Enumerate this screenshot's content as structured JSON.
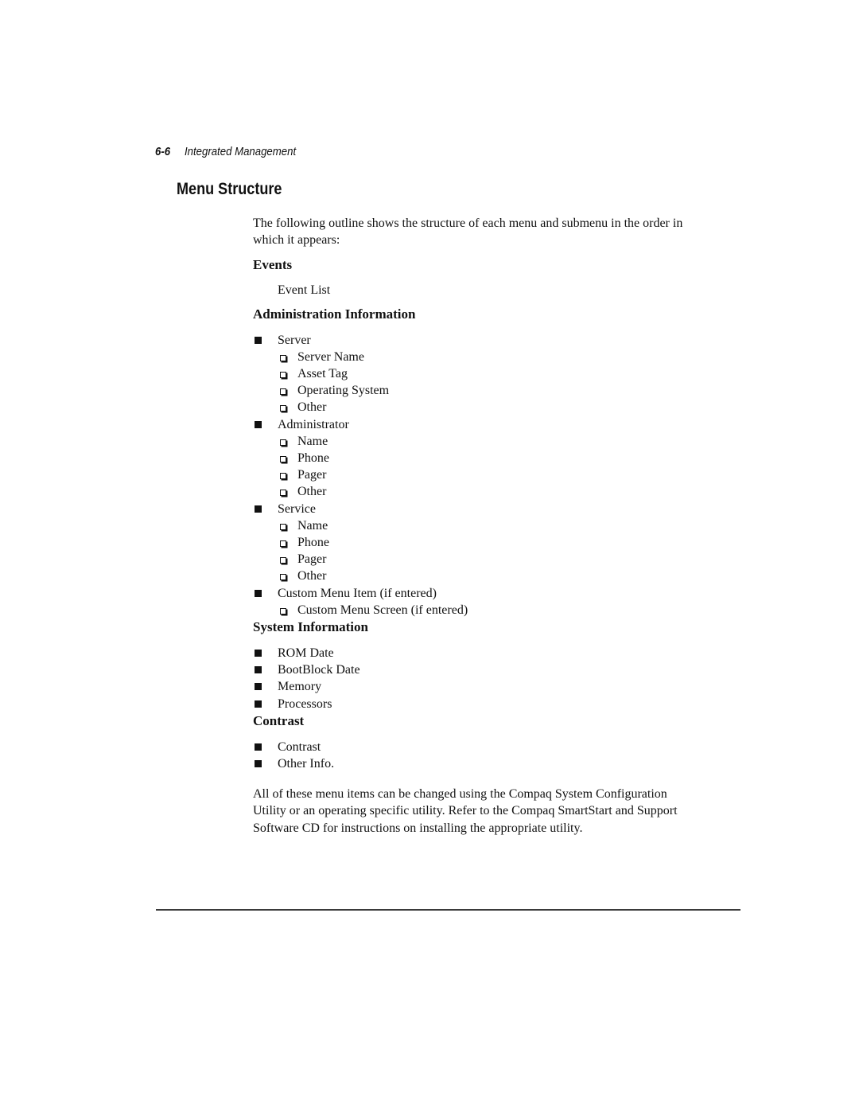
{
  "header": {
    "page_number": "6-6",
    "chapter_title": "Integrated Management"
  },
  "section_title": "Menu Structure",
  "intro": "The following outline shows the structure of each menu and submenu in the order in which it appears:",
  "menus": [
    {
      "title": "Events",
      "plain_items": [
        "Event List"
      ]
    },
    {
      "title": "Administration Information",
      "items": [
        {
          "label": "Server",
          "children": [
            "Server Name",
            "Asset Tag",
            "Operating System",
            "Other"
          ]
        },
        {
          "label": "Administrator",
          "children": [
            "Name",
            "Phone",
            "Pager",
            "Other"
          ]
        },
        {
          "label": "Service",
          "children": [
            "Name",
            "Phone",
            "Pager",
            "Other"
          ]
        },
        {
          "label": "Custom Menu Item (if entered)",
          "children": [
            "Custom Menu Screen (if entered)"
          ]
        }
      ]
    },
    {
      "title": "System Information",
      "items": [
        {
          "label": "ROM Date"
        },
        {
          "label": "BootBlock Date"
        },
        {
          "label": "Memory"
        },
        {
          "label": "Processors"
        }
      ]
    },
    {
      "title": "Contrast",
      "items": [
        {
          "label": "Contrast"
        },
        {
          "label": "Other Info."
        }
      ]
    }
  ],
  "closing": "All of these menu items can be changed using the Compaq System Configuration Utility or an operating specific utility.  Refer to the Compaq SmartStart and Support Software CD for instructions on installing the appropriate utility.",
  "icons": {
    "level1_bullet": "filled-square-bullet-icon",
    "level2_bullet": "open-shadowed-square-bullet-icon"
  }
}
